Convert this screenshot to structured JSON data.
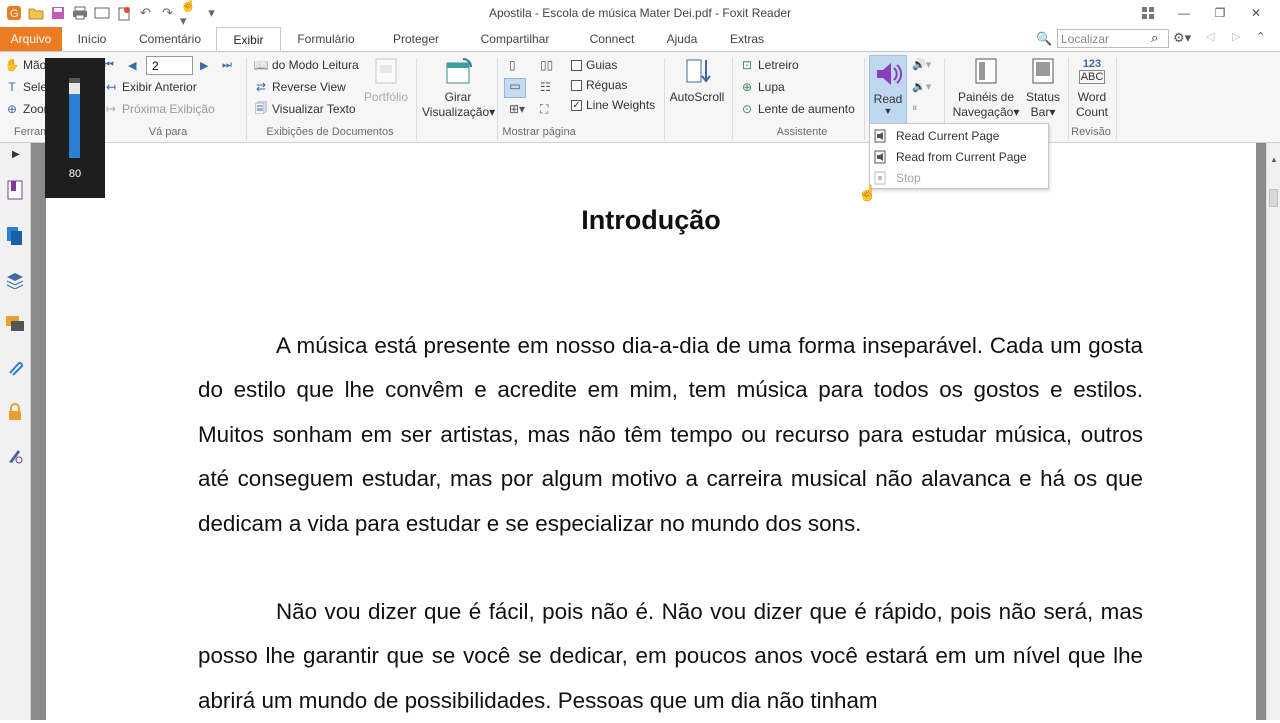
{
  "app_title": "Apostila - Escola de música Mater Dei.pdf - Foxit Reader",
  "tabs": [
    {
      "label": "Arquivo"
    },
    {
      "label": "Início"
    },
    {
      "label": "Comentário"
    },
    {
      "label": "Exibir"
    },
    {
      "label": "Formulário"
    },
    {
      "label": "Proteger"
    },
    {
      "label": "Compartilhar"
    },
    {
      "label": "Connect"
    },
    {
      "label": "Ajuda"
    },
    {
      "label": "Extras"
    }
  ],
  "search_placeholder": "Localizar",
  "ribbon": {
    "ferramentas": {
      "label": "Ferramentas",
      "items": [
        "Mão",
        "Selecionar",
        "Zoom"
      ]
    },
    "vapara": {
      "label": "Vá para",
      "page": "2",
      "prev_view": "Exibir Anterior",
      "next_view": "Próxima Exibição"
    },
    "exibicoes": {
      "label": "Exibições de Documentos",
      "items": [
        "do Modo Leitura",
        "Reverse View",
        "Visualizar Texto"
      ],
      "portfolio": "Portfólio"
    },
    "girar": {
      "line1": "Girar",
      "line2": "Visualização"
    },
    "mostrar": {
      "label": "Mostrar página",
      "guias": "Guias",
      "reguas": "Réguas",
      "line_weights": "Line Weights"
    },
    "autoscroll": "AutoScroll",
    "assistente": {
      "label": "Assistente",
      "items": [
        "Letreiro",
        "Lupa",
        "Lente de aumento"
      ]
    },
    "read": "Read",
    "paineis": {
      "line1": "Painéis de",
      "line2": "Navegação"
    },
    "status": {
      "line1": "Status",
      "line2": "Bar"
    },
    "word": {
      "icon_top": "123",
      "icon_bottom": "ABC",
      "line1": "Word",
      "line2": "Count"
    },
    "revisao": "Revisão"
  },
  "read_menu": {
    "items": [
      "Read Current Page",
      "Read from Current Page",
      "Stop"
    ]
  },
  "volume": {
    "value": "80",
    "level": 0.8
  },
  "document": {
    "title": "Introdução",
    "paragraphs": [
      "A música está presente em nosso dia-a-dia de uma forma inseparável. Cada um gosta do estilo que lhe convêm e acredite em mim, tem música para todos os gostos e estilos. Muitos sonham em ser artistas, mas não têm tempo ou recurso para estudar música, outros até conseguem estudar, mas por algum motivo a carreira musical não alavanca e há os que dedicam a vida para estudar e se especializar no mundo dos sons.",
      "Não vou dizer que é fácil, pois não é. Não vou dizer que é rápido, pois não será, mas posso lhe garantir que se você se dedicar, em poucos anos você estará em um nível que lhe abrirá um mundo de possibilidades. Pessoas que um dia não tinham"
    ]
  },
  "colors": {
    "accent": "#ec7b21",
    "read_highlight": "#bfd7ef",
    "volume_fill": "#2a7fd4"
  }
}
